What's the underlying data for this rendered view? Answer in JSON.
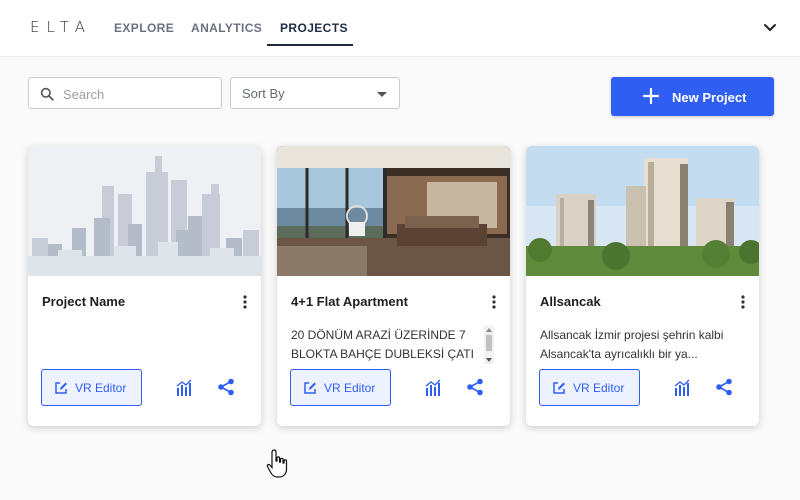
{
  "app": {
    "logo": "ELTA"
  },
  "nav": {
    "tabs": [
      {
        "label": "EXPLORE",
        "active": false
      },
      {
        "label": "ANALYTICS",
        "active": false
      },
      {
        "label": "PROJECTS",
        "active": true
      }
    ]
  },
  "toolbar": {
    "search_placeholder": "Search",
    "search_value": "",
    "sort_label": "Sort By",
    "new_project_label": "New Project"
  },
  "colors": {
    "accent": "#2f5ff2",
    "nav_active": "#1f2a44"
  },
  "cards": [
    {
      "title": "Project Name",
      "description": "",
      "vr_label": "VR Editor"
    },
    {
      "title": "4+1 Flat Apartment",
      "description": "20 DÖNÜM ARAZİ ÜZERİNDE 7 BLOKTA BAHÇE DUBLEKSİ ÇATI",
      "vr_label": "VR Editor"
    },
    {
      "title": "Allsancak",
      "description": "Allsancak İzmir projesi şehrin kalbi Alsancak'ta ayrıcalıklı bir ya...",
      "vr_label": "VR Editor"
    }
  ],
  "icons": [
    "search-icon",
    "chevron-down-icon",
    "plus-icon",
    "kebab-menu-icon",
    "edit-icon",
    "analytics-icon",
    "share-icon",
    "hand-cursor-icon"
  ]
}
